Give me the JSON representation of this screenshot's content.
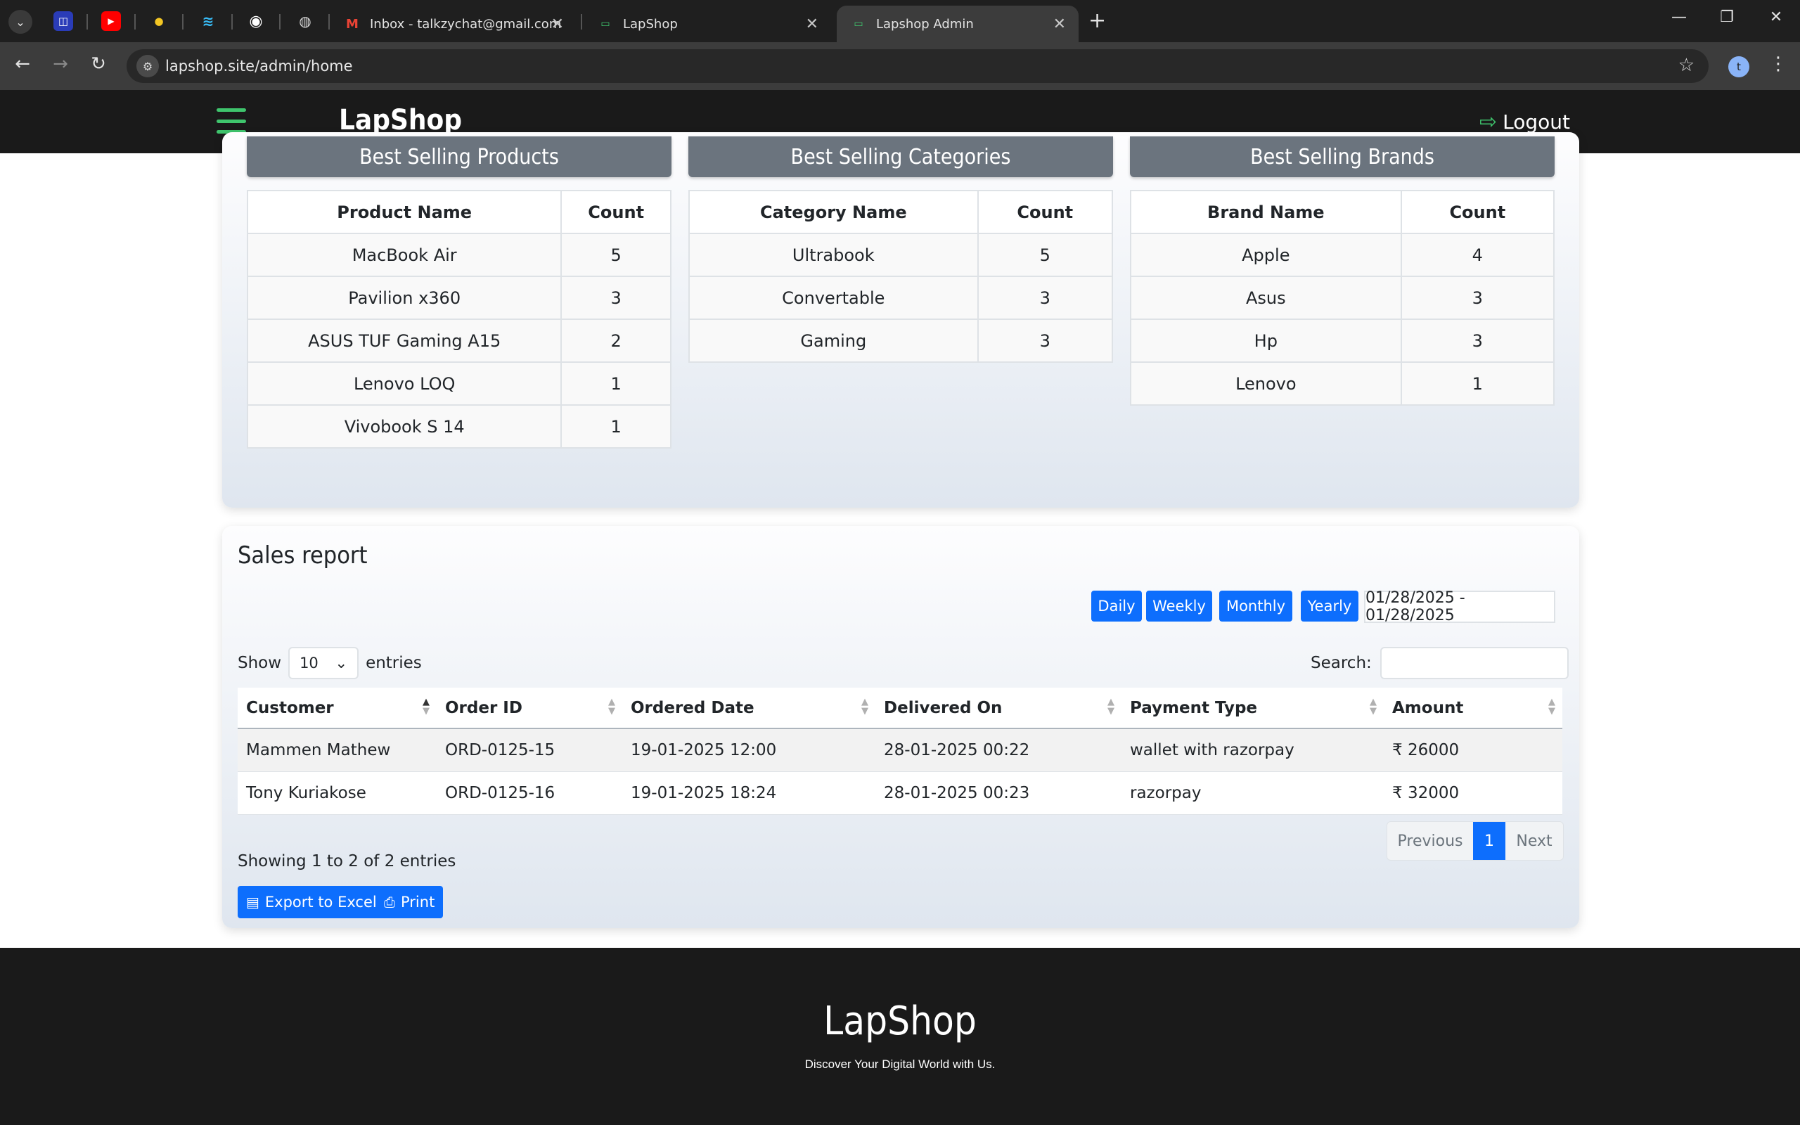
{
  "browser": {
    "tabs": [
      {
        "title": "Inbox - talkzychat@gmail.com",
        "icon": "gmail-icon"
      },
      {
        "title": "LapShop",
        "icon": "lapshop-favicon"
      },
      {
        "title": "Lapshop Admin",
        "icon": "lapshop-favicon",
        "active": true
      }
    ],
    "url": "lapshop.site/admin/home",
    "profile_initial": "t"
  },
  "navbar": {
    "brand": "LapShop",
    "logout_label": "Logout",
    "accent_color": "#3fc56d"
  },
  "best_selling": {
    "products": {
      "title": "Best Selling Products",
      "columns": [
        "Product Name",
        "Count"
      ],
      "rows": [
        [
          "MacBook Air",
          "5"
        ],
        [
          "Pavilion x360",
          "3"
        ],
        [
          "ASUS TUF Gaming A15",
          "2"
        ],
        [
          "Lenovo LOQ",
          "1"
        ],
        [
          "Vivobook S 14",
          "1"
        ]
      ]
    },
    "categories": {
      "title": "Best Selling Categories",
      "columns": [
        "Category Name",
        "Count"
      ],
      "rows": [
        [
          "Ultrabook",
          "5"
        ],
        [
          "Convertable",
          "3"
        ],
        [
          "Gaming",
          "3"
        ]
      ]
    },
    "brands": {
      "title": "Best Selling Brands",
      "columns": [
        "Brand Name",
        "Count"
      ],
      "rows": [
        [
          "Apple",
          "4"
        ],
        [
          "Asus",
          "3"
        ],
        [
          "Hp",
          "3"
        ],
        [
          "Lenovo",
          "1"
        ]
      ]
    }
  },
  "sales_report": {
    "title": "Sales report",
    "filters": [
      "Daily",
      "Weekly",
      "Monthly",
      "Yearly"
    ],
    "date_range": "01/28/2025 - 01/28/2025",
    "show_label": "Show",
    "entries_label": "entries",
    "page_length": "10",
    "search_label": "Search:",
    "search_value": "",
    "columns": [
      "Customer",
      "Order ID",
      "Ordered Date",
      "Delivered On",
      "Payment Type",
      "Amount"
    ],
    "rows": [
      [
        "Mammen Mathew",
        "ORD-0125-15",
        "19-01-2025 12:00",
        "28-01-2025 00:22",
        "wallet with razorpay",
        "₹ 26000"
      ],
      [
        "Tony Kuriakose",
        "ORD-0125-16",
        "19-01-2025 18:24",
        "28-01-2025 00:23",
        "razorpay",
        "₹ 32000"
      ]
    ],
    "info": "Showing 1 to 2 of 2 entries",
    "pagination": {
      "previous": "Previous",
      "current": "1",
      "next": "Next"
    },
    "export_label": "Export to Excel",
    "print_label": "Print",
    "primary_color": "#0d6efd"
  },
  "footer": {
    "brand": "LapShop",
    "tagline": "Discover Your Digital World with Us."
  }
}
